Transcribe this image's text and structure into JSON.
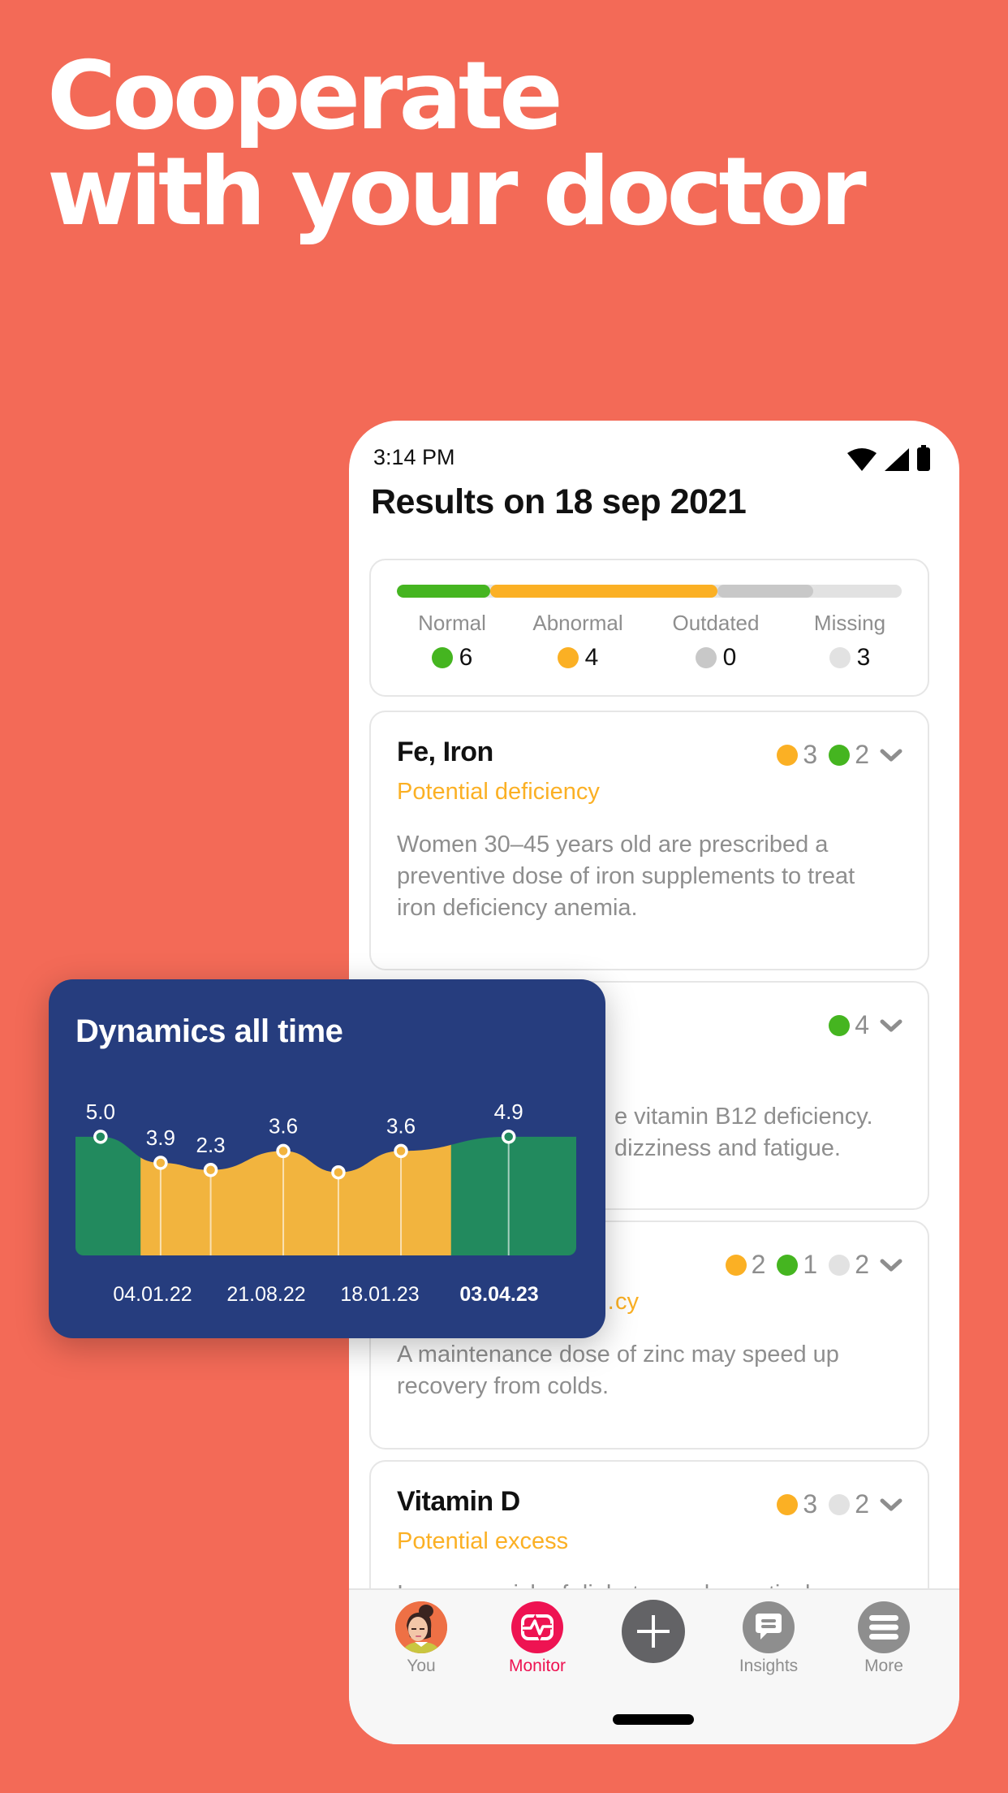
{
  "headline": {
    "line1": "Cooperate",
    "line2": "with your doctor"
  },
  "colors": {
    "background": "#F36A57",
    "normal": "#45B520",
    "abnormal": "#FBB024",
    "outdated": "#C8C8C8",
    "missing": "#E2E2E2",
    "accent": "#EE1352",
    "chart_bg": "#263D7E",
    "chart_normal": "#228A5E",
    "chart_abnormal": "#F2B43E"
  },
  "status_bar": {
    "time": "3:14 PM",
    "icons": [
      "wifi-icon",
      "signal-icon",
      "battery-icon"
    ]
  },
  "page": {
    "title": "Results on 18 sep 2021"
  },
  "summary": {
    "items": [
      {
        "label": "Normal",
        "count": "6",
        "status": "normal"
      },
      {
        "label": "Abnormal",
        "count": "4",
        "status": "abnormal"
      },
      {
        "label": "Outdated",
        "count": "0",
        "status": "outdated"
      },
      {
        "label": "Missing",
        "count": "3",
        "status": "missing"
      }
    ],
    "bar_fractions": {
      "normal": 0.185,
      "abnormal": 0.45,
      "outdated": 0.19,
      "missing": 0.175
    }
  },
  "biomarkers": [
    {
      "name": "Fe, Iron",
      "status": "Potential deficiency",
      "description": "Women 30–45 years old are prescribed a preventive dose of iron supplements to treat iron deficiency anemia.",
      "badges": [
        {
          "status": "abnormal",
          "count": "3"
        },
        {
          "status": "normal",
          "count": "2"
        }
      ]
    },
    {
      "name": "",
      "status": "",
      "description": "… vitamin B12 deficiency. … dizziness and fatigue.",
      "visible_description_lines": [
        "e vitamin B12 deficiency.",
        "dizziness and fatigue."
      ],
      "badges": [
        {
          "status": "normal",
          "count": "4"
        }
      ]
    },
    {
      "name": "",
      "status": "…cy",
      "description": "A maintenance dose of zinc may speed up recovery from colds.",
      "badges": [
        {
          "status": "abnormal",
          "count": "2"
        },
        {
          "status": "normal",
          "count": "1"
        },
        {
          "status": "missing",
          "count": "2"
        }
      ]
    },
    {
      "name": "Vitamin D",
      "status": "Potential excess",
      "description": "Increases risk of diabetes and negatively",
      "badges": [
        {
          "status": "abnormal",
          "count": "3"
        },
        {
          "status": "missing",
          "count": "2"
        }
      ]
    }
  ],
  "tabbar": {
    "items": [
      {
        "label": "You",
        "icon": "avatar",
        "active": false
      },
      {
        "label": "Monitor",
        "icon": "monitor-icon",
        "active": true
      },
      {
        "label": "",
        "icon": "plus-icon",
        "active": false
      },
      {
        "label": "Insights",
        "icon": "chat-icon",
        "active": false
      },
      {
        "label": "More",
        "icon": "menu-icon",
        "active": false
      }
    ]
  },
  "chart_data": {
    "type": "area",
    "title": "Dynamics all time",
    "xlabel": "",
    "ylabel": "",
    "ylim": [
      0,
      6.5
    ],
    "grid": false,
    "legend": "none",
    "points": [
      {
        "value": 5.0,
        "label": "5.0",
        "zone": "normal"
      },
      {
        "value": 3.9,
        "label": "3.9",
        "zone": "abnormal"
      },
      {
        "value": 3.6,
        "label": "2.3",
        "zone": "abnormal"
      },
      {
        "value": 4.4,
        "label": "3.6",
        "zone": "abnormal"
      },
      {
        "value": 3.5,
        "label": "",
        "zone": "abnormal"
      },
      {
        "value": 4.4,
        "label": "3.6",
        "zone": "abnormal"
      },
      {
        "value": 5.0,
        "label": "4.9",
        "zone": "normal"
      }
    ],
    "x_ticks": [
      {
        "label": "04.01.22",
        "bold": false
      },
      {
        "label": "21.08.22",
        "bold": false
      },
      {
        "label": "18.01.23",
        "bold": false
      },
      {
        "label": "03.04.23",
        "bold": true
      }
    ],
    "zones": [
      {
        "name": "normal",
        "from_index": 0,
        "to_fraction": 0.13
      },
      {
        "name": "abnormal",
        "from_fraction": 0.13,
        "to_fraction": 0.75
      },
      {
        "name": "normal",
        "from_fraction": 0.75,
        "to_fraction": 1.0
      }
    ]
  }
}
